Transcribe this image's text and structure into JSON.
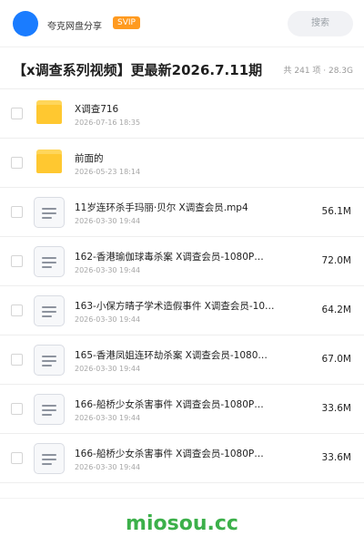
{
  "header": {
    "share_name": "夸克网盘分享",
    "badge": "SVIP",
    "search_label": "搜索"
  },
  "page": {
    "title": "【x调查系列视频】更最新2026.7.11期",
    "summary": "共 241 项 · 28.3G"
  },
  "files": [
    {
      "type": "folder",
      "name": "X调查716",
      "date": "2026-07-16 18:35",
      "size": ""
    },
    {
      "type": "folder",
      "name": "前面的",
      "date": "2026-05-23 18:14",
      "size": ""
    },
    {
      "type": "file",
      "name": "11岁连环杀手玛丽·贝尔 X调查会员.mp4",
      "date": "2026-03-30 19:44",
      "size": "56.1M"
    },
    {
      "type": "file",
      "name": "162-香港瑜伽球毒杀案 X调查会员-1080P…",
      "date": "2026-03-30 19:44",
      "size": "72.0M"
    },
    {
      "type": "file",
      "name": "163-小保方晴子学术造假事件 X调查会员-10…",
      "date": "2026-03-30 19:44",
      "size": "64.2M"
    },
    {
      "type": "file",
      "name": "165-香港凤姐连环劫杀案 X调查会员-1080…",
      "date": "2026-03-30 19:44",
      "size": "67.0M"
    },
    {
      "type": "file",
      "name": "166-船桥少女杀害事件 X调查会员-1080P…",
      "date": "2026-03-30 19:44",
      "size": "33.6M"
    },
    {
      "type": "file",
      "name": "166-船桥少女杀害事件 X调查会员-1080P…",
      "date": "2026-03-30 19:44",
      "size": "33.6M"
    }
  ],
  "footer": {
    "watermark": "miosou.cc"
  },
  "colors": {
    "accent": "#1a7cff",
    "badge": "#ff9a1f",
    "folder": "#ffc830",
    "watermark": "#3cb04a"
  }
}
